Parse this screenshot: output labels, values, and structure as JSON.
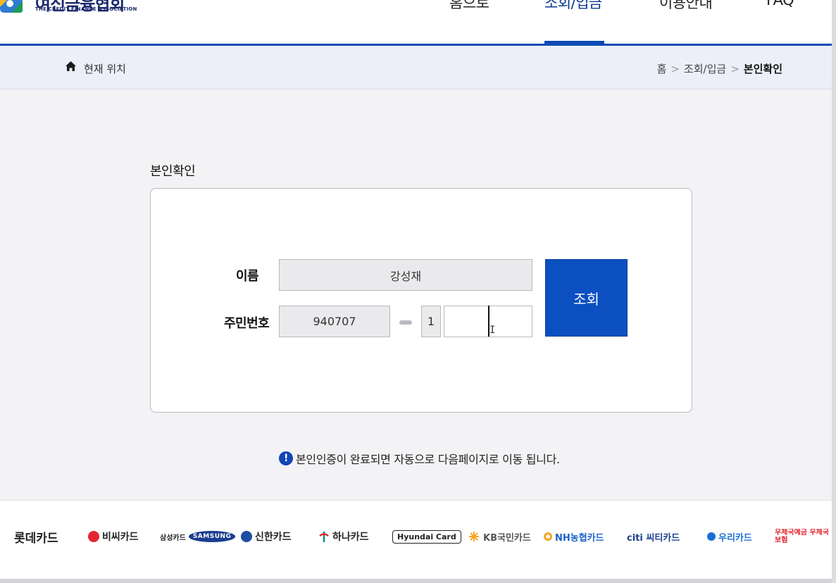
{
  "header": {
    "logo_korean": "여신금융협회",
    "logo_english": "THE CREDIT FINANCE ASSOCIATION",
    "nav": [
      "홈으로",
      "조회/입금",
      "이용안내",
      "FAQ"
    ],
    "active_nav_index": 1
  },
  "breadcrumb": {
    "current_location_label": "현재 위치",
    "items": [
      "홈",
      "조회/입금",
      "본인확인"
    ],
    "separator": ">"
  },
  "main": {
    "section_title": "본인확인",
    "form": {
      "name_label": "이름",
      "name_value": "강성재",
      "rrn_label": "주민번호",
      "rrn_front_value": "940707",
      "rrn_gender_digit": "1",
      "rrn_back_value": "",
      "submit_label": "조회"
    },
    "notice_icon": "!",
    "notice": "본인인증이 완료되면 자동으로 다음페이지로 이동 됩니다."
  },
  "footer": {
    "brands": [
      {
        "name": "롯데카드",
        "icon": ""
      },
      {
        "name": "비씨카드",
        "icon": "bc-icon"
      },
      {
        "name": "삼성카드",
        "extra": "SAMSUNG"
      },
      {
        "name": "신한카드",
        "icon": "shinhan-icon"
      },
      {
        "name": "하나카드",
        "icon": "hana-icon"
      },
      {
        "name": "Hyundai Card",
        "icon": ""
      },
      {
        "name": "KB국민카드",
        "icon": "kb-icon"
      },
      {
        "name": "NH농협카드",
        "icon": "nh-icon"
      },
      {
        "name": "citi 씨티카드",
        "icon": ""
      },
      {
        "name": "우리카드",
        "icon": "woori-icon"
      },
      {
        "name": "우체국예금 우체국보험",
        "icon": ""
      }
    ]
  },
  "colors": {
    "primary_blue": "#0b4fc0",
    "nav_accent": "#0b4ab5",
    "crumb_band": "#eceff7",
    "main_bg": "#f3f3f5",
    "field_bg": "#eae9ec"
  }
}
